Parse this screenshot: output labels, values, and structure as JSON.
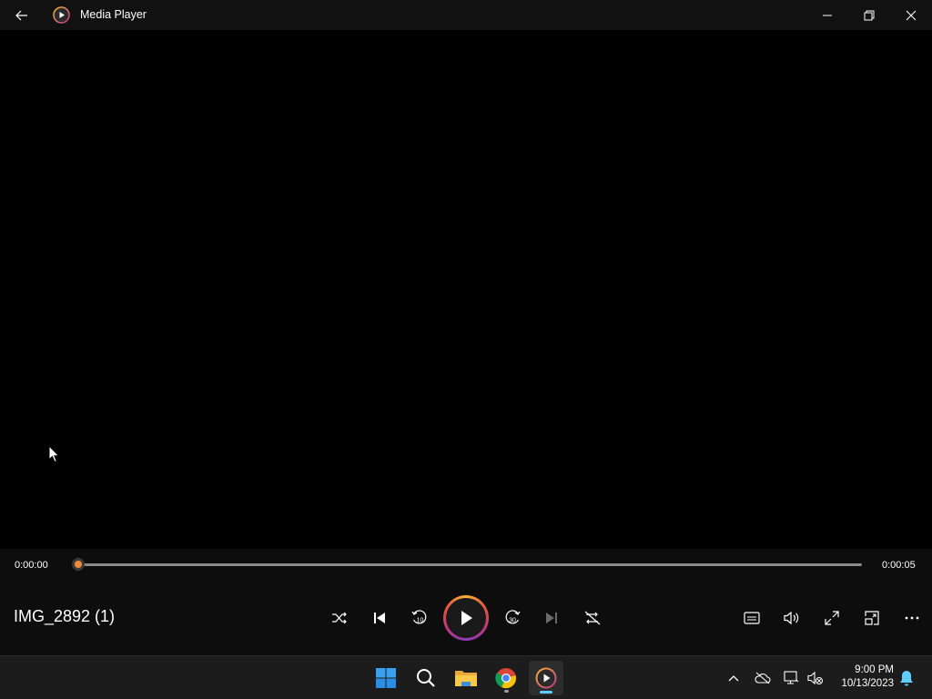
{
  "window": {
    "app_title": "Media Player",
    "back_icon": "back-arrow-icon",
    "minimize_icon": "minimize-icon",
    "restore_icon": "restore-icon",
    "close_icon": "close-icon"
  },
  "player": {
    "current_time": "0:00:00",
    "total_time": "0:00:05",
    "progress": 0.0,
    "media_title": "IMG_2892 (1)",
    "accent_color": "#f08a3a",
    "controls": {
      "shuffle": "shuffle-icon",
      "previous": "previous-icon",
      "skip_back": "10",
      "play": "play-icon",
      "skip_forward": "30",
      "next": "next-icon",
      "repeat": "repeat-icon",
      "captions": "captions-icon",
      "volume": "volume-icon",
      "fullscreen": "fullscreen-icon",
      "miniplayer": "miniplayer-icon",
      "more": "more-icon"
    }
  },
  "taskbar": {
    "apps": [
      "start",
      "search",
      "file-explorer",
      "chrome",
      "media-player"
    ],
    "time": "9:00 PM",
    "date": "10/13/2023",
    "active_color": "#60cdff"
  }
}
